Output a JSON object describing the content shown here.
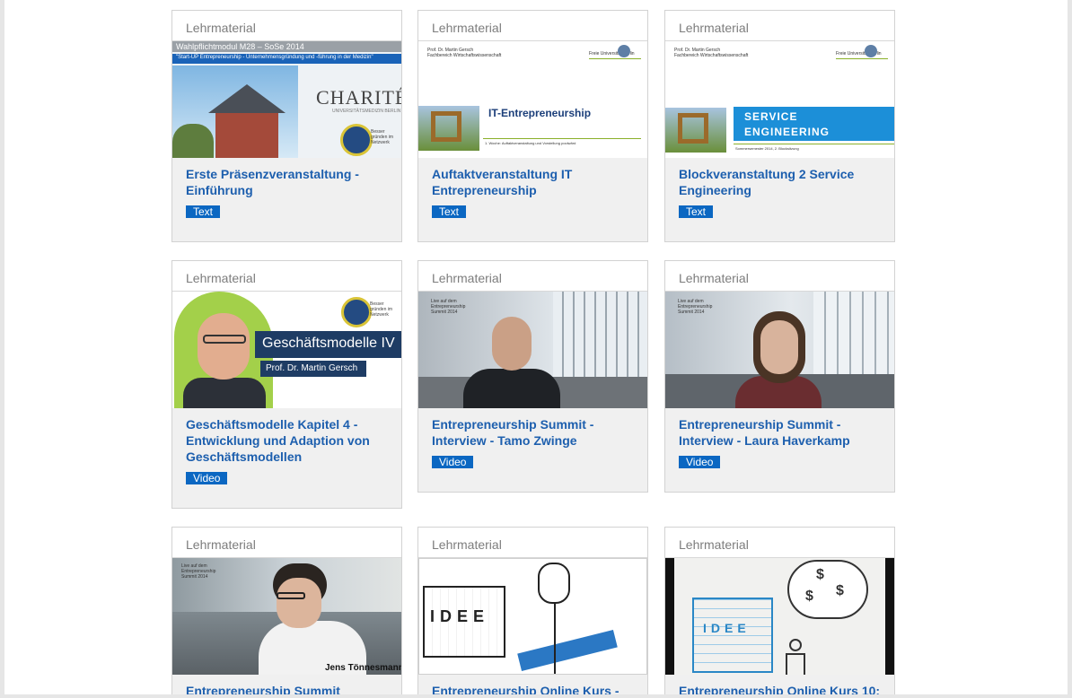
{
  "cards": [
    {
      "category": "Lehrmaterial",
      "title": "Erste Präsenzveranstaltung - Einführung",
      "badge": "Text",
      "thumb": {
        "header_text": "Wahlpflichtmodul M28 – SoSe 2014",
        "banner_text": "\"Start-UP Entrepreneurship - Unternehmensgründung und -führung in der Medizin\"",
        "logo_text": "CHARITÉ",
        "logo_sub": "UNIVERSITÄTSMEDIZIN BERLIN",
        "seal_text": "Besser gründen im Netzwerk"
      }
    },
    {
      "category": "Lehrmaterial",
      "title": "Auftaktveranstaltung IT Entrepreneurship",
      "badge": "Text",
      "thumb": {
        "author_text": "Prof. Dr. Martin Gersch",
        "dept_text": "Fachbereich Wirtschaftswissenschaft",
        "uni_text": "Freie Universität Berlin",
        "slide_title": "IT-Entrepreneurship",
        "slide_sub": "1. Woche: Auftaktveranstaltung und Vorstellung poolwärd"
      }
    },
    {
      "category": "Lehrmaterial",
      "title": "Blockveranstaltung 2 Service Engineering",
      "badge": "Text",
      "thumb": {
        "author_text": "Prof. Dr. Martin Gersch",
        "dept_text": "Fachbereich Wirtschaftswissenschaft",
        "uni_text": "Freie Universität Berlin",
        "line1": "SERVICE",
        "line2": "ENGINEERING",
        "footer_text": "Sommersemester 2014, 2. Blocksitzung"
      }
    },
    {
      "category": "Lehrmaterial",
      "title": "Geschäftsmodelle Kapitel 4 - Entwicklung und Adaption von Geschäftsmodellen",
      "badge": "Video",
      "thumb": {
        "heading": "Geschäftsmodelle IV",
        "name": "Prof. Dr. Martin Gersch",
        "seal_text": "Besser gründen im Netzwerk"
      }
    },
    {
      "category": "Lehrmaterial",
      "title": "Entrepreneurship Summit - Interview - Tamo Zwinge",
      "badge": "Video",
      "thumb": {
        "live_text": "Live auf dem Entrepreneurship Summit 2014"
      }
    },
    {
      "category": "Lehrmaterial",
      "title": "Entrepreneurship Summit - Interview - Laura Haverkamp",
      "badge": "Video",
      "thumb": {
        "live_text": "Live auf dem Entrepreneurship Summit 2014"
      }
    },
    {
      "category": "Lehrmaterial",
      "title": "Entrepreneurship Summit",
      "badge": "",
      "thumb": {
        "live_text": "Live auf dem Entrepreneurship Summit 2014",
        "name": "Jens Tönnesmann"
      }
    },
    {
      "category": "Lehrmaterial",
      "title": "Entrepreneurship Online Kurs - das",
      "badge": "",
      "thumb": {
        "letters": "IDEE"
      }
    },
    {
      "category": "Lehrmaterial",
      "title": "Entrepreneurship Online Kurs 10:",
      "badge": "",
      "thumb": {
        "letters": "IDEE",
        "money": "$"
      }
    }
  ]
}
